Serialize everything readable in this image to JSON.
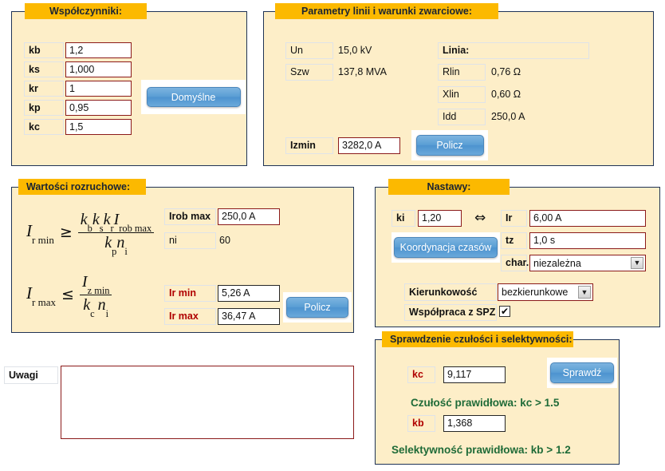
{
  "panel_wspolczynniki": {
    "title": "Współczynniki:",
    "rows": [
      {
        "label": "kb",
        "value": "1,2"
      },
      {
        "label": "ks",
        "value": "1,000"
      },
      {
        "label": "kr",
        "value": "1"
      },
      {
        "label": "kp",
        "value": "0,95"
      },
      {
        "label": "kc",
        "value": "1,5"
      }
    ],
    "default_button": "Domyślne"
  },
  "panel_linia": {
    "title": "Parametry linii i warunki zwarciowe:",
    "un_label": "Un",
    "un_value": "15,0 kV",
    "szw_label": "Szw",
    "szw_value": "137,8 MVA",
    "linia_label": "Linia:",
    "rlin_label": "Rlin",
    "rlin_value": "0,76 Ω",
    "xlin_label": "Xlin",
    "xlin_value": "0,60 Ω",
    "idd_label": "Idd",
    "idd_value": "250,0 A",
    "izmin_label": "Izmin",
    "izmin_value": "3282,0 A",
    "calc_button": "Policz"
  },
  "panel_rozruchowe": {
    "title": "Wartości rozruchowe:",
    "formula1": {
      "lhs_main": "I",
      "lhs_sub": "r min",
      "relation": "≥",
      "numerator": "kb ks kr Irob max",
      "denominator": "kp ni"
    },
    "formula2": {
      "lhs_main": "I",
      "lhs_sub": "r max",
      "relation": "≤",
      "numerator": "Iz min",
      "denominator": "kc ni"
    },
    "irobmax_label": "Irob max",
    "irobmax_value": "250,0 A",
    "ni_label": "ni",
    "ni_value": "60",
    "irmin_label": "Ir min",
    "irmin_value": "5,26 A",
    "irmax_label": "Ir max",
    "irmax_value": "36,47 A",
    "calc_button": "Policz"
  },
  "panel_nastawy": {
    "title": "Nastawy:",
    "ki_label": "ki",
    "ki_value": "1,20",
    "equiv_icon": "⇔",
    "ir_label": "Ir",
    "ir_value": "6,00 A",
    "tz_label": "tz",
    "tz_value": "1,0 s",
    "char_label": "char.",
    "char_value": "niezależna",
    "coordination_button": "Koordynacja czasów",
    "kierunkowosc_label": "Kierunkowość",
    "kierunkowosc_value": "bezkierunkowe",
    "spz_label": "Współpraca z SPZ",
    "spz_checked": "✔"
  },
  "panel_sprawdzenie": {
    "title": "Sprawdzenie czułości i selektywności:",
    "kc_label": "kc",
    "kc_value": "9,117",
    "kb_label": "kb",
    "kb_value": "1,368",
    "check_button": "Sprawdź",
    "result_czulosc": "Czułość prawidłowa: kc >  1.5",
    "result_selektywnosc": "Selektywność prawidłowa: kb >  1.2"
  },
  "notes": {
    "label": "Uwagi",
    "value": ""
  }
}
